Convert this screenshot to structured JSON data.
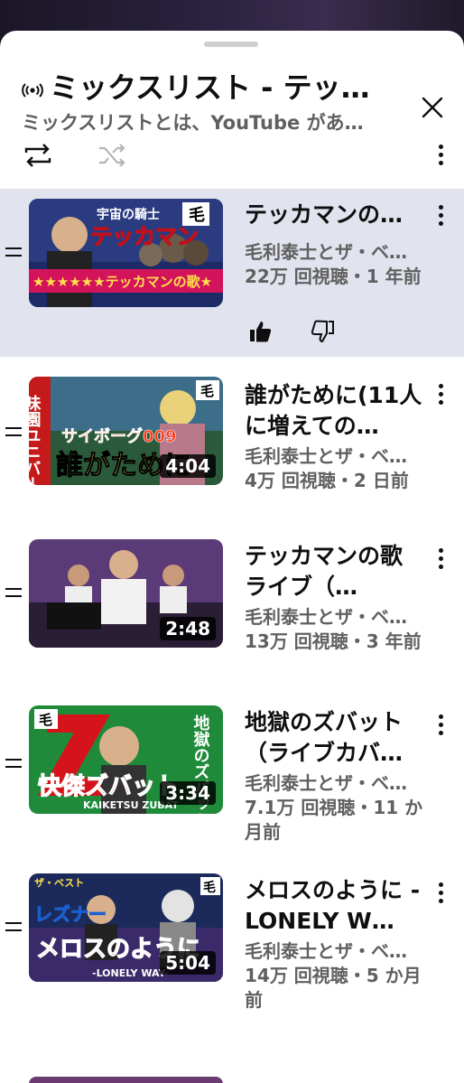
{
  "header": {
    "title": "ミックスリスト - テッ…",
    "subtitle": "ミックスリストとは、YouTube があ…"
  },
  "controls": {
    "loop": "loop-icon",
    "shuffle": "shuffle-icon",
    "more": "more-icon"
  },
  "items": [
    {
      "title": "テッカマンの…",
      "channel": "毛利泰士とザ・ベ…",
      "meta": "22万 回視聴・1 年前",
      "duration": "",
      "active": true,
      "thumb_text": [
        "宇宙の騎士",
        "テッカマン",
        "★★★★★★テッカマンの歌★"
      ]
    },
    {
      "title": "誰がために(11人に増えての…",
      "channel": "毛利泰士とザ・ベ…",
      "meta": "4万 回視聴・2 日前",
      "duration": "4:04",
      "thumb_text": [
        "味園ユニバース",
        "サイボーグ009",
        "誰がために"
      ]
    },
    {
      "title": "テッカマンの歌　ライブ（…",
      "channel": "毛利泰士とザ・ベ…",
      "meta": "13万 回視聴・3 年前",
      "duration": "2:48"
    },
    {
      "title": "地獄のズバット（ライブカバ…",
      "channel": "毛利泰士とザ・ベ…",
      "meta": "7.1万 回視聴・11 か月前",
      "duration": "3:34",
      "thumb_text": [
        "地獄のズバット",
        "快傑ズバット",
        "KAIKETSU ZUBAT"
      ]
    },
    {
      "title": "メロスのように -LONELY W…",
      "channel": "毛利泰士とザ・ベ…",
      "meta": "14万 回視聴・5 か月前",
      "duration": "5:04",
      "thumb_text": [
        "レズナー",
        "メロスのように",
        "-LONELY WAY-"
      ]
    }
  ],
  "colors": {
    "active_bg": "#e1e3ee",
    "secondary_text": "#606060"
  }
}
